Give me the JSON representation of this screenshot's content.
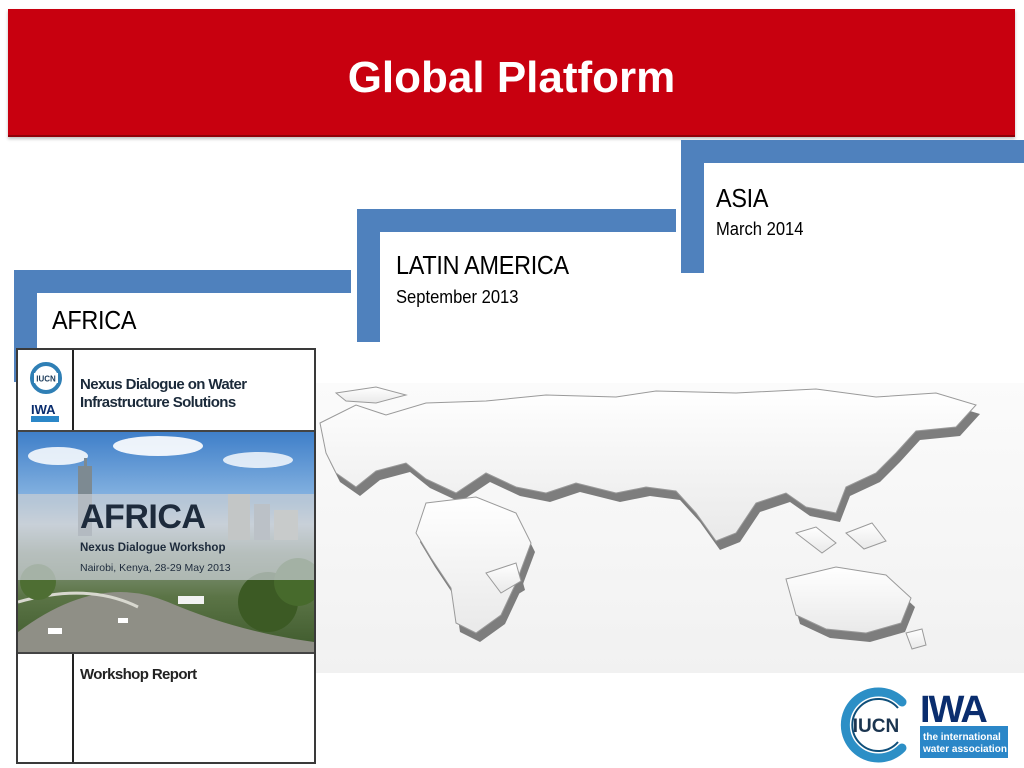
{
  "slide": {
    "title": "Global Platform",
    "colors": {
      "title_bar": "#c8000f",
      "bracket": "#4f81bd",
      "title_text": "#ffffff"
    }
  },
  "regions": [
    {
      "name": "AFRICA",
      "date": ""
    },
    {
      "name": "LATIN AMERICA",
      "date": "September 2013"
    },
    {
      "name": "ASIA",
      "date": "March 2014"
    }
  ],
  "report_cover": {
    "title_line1": "Nexus Dialogue on Water",
    "title_line2": "Infrastructure Solutions",
    "region": "AFRICA",
    "subtitle": "Nexus Dialogue Workshop",
    "place_date": "Nairobi, Kenya, 28-29 May 2013",
    "footer": "Workshop Report",
    "logos": [
      "IUCN",
      "IWA"
    ]
  },
  "map": {
    "icon": "world-map-3d-icon"
  },
  "logos": {
    "iucn": "IUCN",
    "iwa": "IWA",
    "iwa_tagline_1": "the international",
    "iwa_tagline_2": "water association"
  }
}
